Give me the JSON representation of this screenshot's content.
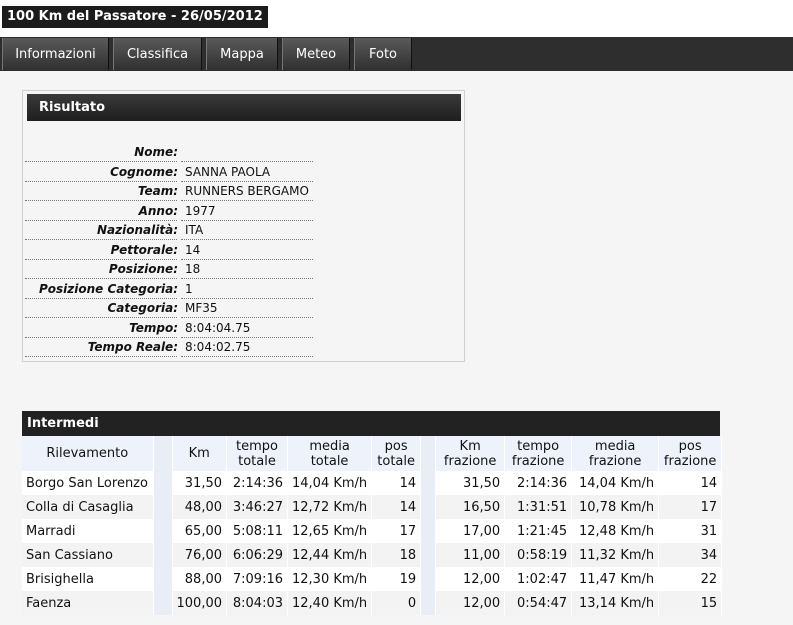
{
  "page": {
    "title": "100 Km del Passatore - 26/05/2012"
  },
  "tabs": [
    {
      "label": "Informazioni"
    },
    {
      "label": "Classifica"
    },
    {
      "label": "Mappa"
    },
    {
      "label": "Meteo"
    },
    {
      "label": "Foto"
    }
  ],
  "result": {
    "header": "Risultato",
    "fields": [
      {
        "label": "Nome:",
        "value": ""
      },
      {
        "label": "Cognome:",
        "value": "SANNA PAOLA"
      },
      {
        "label": "Team:",
        "value": "RUNNERS BERGAMO"
      },
      {
        "label": "Anno:",
        "value": "1977"
      },
      {
        "label": "Nazionalità:",
        "value": "ITA"
      },
      {
        "label": "Pettorale:",
        "value": "14"
      },
      {
        "label": "Posizione:",
        "value": "18"
      },
      {
        "label": "Posizione Categoria:",
        "value": "1"
      },
      {
        "label": "Categoria:",
        "value": "MF35"
      },
      {
        "label": "Tempo:",
        "value": "8:04:04.75"
      },
      {
        "label": "Tempo Reale:",
        "value": "8:04:02.75"
      }
    ]
  },
  "intermediates": {
    "header": "Intermedi",
    "columns": {
      "rilevamento": "Rilevamento",
      "km": "Km",
      "tempo_totale": [
        "tempo",
        "totale"
      ],
      "media_totale": [
        "media",
        "totale"
      ],
      "pos_totale": [
        "pos",
        "totale"
      ],
      "km_frazione": [
        "Km",
        "frazione"
      ],
      "tempo_frazione": [
        "tempo",
        "frazione"
      ],
      "media_frazione": [
        "media",
        "frazione"
      ],
      "pos_frazione": [
        "pos",
        "frazione"
      ]
    },
    "rows": [
      {
        "place": "Borgo San Lorenzo",
        "km": "31,50",
        "tempo_totale": "2:14:36",
        "media_totale": "14,04 Km/h",
        "pos_totale": "14",
        "km_frazione": "31,50",
        "tempo_frazione": "2:14:36",
        "media_frazione": "14,04 Km/h",
        "pos_frazione": "14"
      },
      {
        "place": "Colla di Casaglia",
        "km": "48,00",
        "tempo_totale": "3:46:27",
        "media_totale": "12,72 Km/h",
        "pos_totale": "14",
        "km_frazione": "16,50",
        "tempo_frazione": "1:31:51",
        "media_frazione": "10,78 Km/h",
        "pos_frazione": "17"
      },
      {
        "place": "Marradi",
        "km": "65,00",
        "tempo_totale": "5:08:11",
        "media_totale": "12,65 Km/h",
        "pos_totale": "17",
        "km_frazione": "17,00",
        "tempo_frazione": "1:21:45",
        "media_frazione": "12,48 Km/h",
        "pos_frazione": "31"
      },
      {
        "place": "San Cassiano",
        "km": "76,00",
        "tempo_totale": "6:06:29",
        "media_totale": "12,44 Km/h",
        "pos_totale": "18",
        "km_frazione": "11,00",
        "tempo_frazione": "0:58:19",
        "media_frazione": "11,32 Km/h",
        "pos_frazione": "34"
      },
      {
        "place": "Brisighella",
        "km": "88,00",
        "tempo_totale": "7:09:16",
        "media_totale": "12,30 Km/h",
        "pos_totale": "19",
        "km_frazione": "12,00",
        "tempo_frazione": "1:02:47",
        "media_frazione": "11,47 Km/h",
        "pos_frazione": "22"
      },
      {
        "place": "Faenza",
        "km": "100,00",
        "tempo_totale": "8:04:03",
        "media_totale": "12,40 Km/h",
        "pos_totale": "0",
        "km_frazione": "12,00",
        "tempo_frazione": "0:54:47",
        "media_frazione": "13,14 Km/h",
        "pos_frazione": "15"
      }
    ]
  }
}
